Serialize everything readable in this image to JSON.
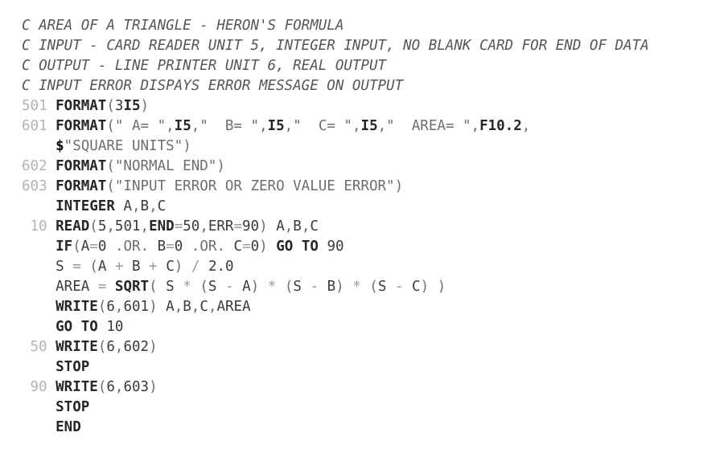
{
  "document": {
    "kind": "fortran-source-listing",
    "language": "FORTRAN",
    "background_color": "#ffffff",
    "text_color": "#3a3a3a",
    "comment_color": "#565656",
    "label_color": "#b4b4b4",
    "operator_color": "#9a9a9a",
    "string_color": "#6e6e6e",
    "keyword_color": "#262626"
  },
  "lines": [
    {
      "type": "comment",
      "label": "",
      "text": "C AREA OF A TRIANGLE - HERON'S FORMULA"
    },
    {
      "type": "comment",
      "label": "",
      "text": "C INPUT - CARD READER UNIT 5, INTEGER INPUT, NO BLANK CARD FOR END OF DATA"
    },
    {
      "type": "comment",
      "label": "",
      "text": "C OUTPUT - LINE PRINTER UNIT 6, REAL OUTPUT"
    },
    {
      "type": "comment",
      "label": "",
      "text": "C INPUT ERROR DISPAYS ERROR MESSAGE ON OUTPUT"
    },
    {
      "type": "statement",
      "label": "501",
      "text": "FORMAT(3I5)"
    },
    {
      "type": "statement",
      "label": "601",
      "text": "FORMAT(\" A= \",I5,\"  B= \",I5,\"  C= \",I5,\"  AREA= \",F10.2,"
    },
    {
      "type": "continuation",
      "label": "",
      "text": "$\"SQUARE UNITS\")"
    },
    {
      "type": "statement",
      "label": "602",
      "text": "FORMAT(\"NORMAL END\")"
    },
    {
      "type": "statement",
      "label": "603",
      "text": "FORMAT(\"INPUT ERROR OR ZERO VALUE ERROR\")"
    },
    {
      "type": "statement",
      "label": "",
      "text": "INTEGER A,B,C"
    },
    {
      "type": "statement",
      "label": "10",
      "text": "READ(5,501,END=50,ERR=90) A,B,C"
    },
    {
      "type": "statement",
      "label": "",
      "text": "IF(A=0 .OR. B=0 .OR. C=0) GO TO 90"
    },
    {
      "type": "statement",
      "label": "",
      "text": "S = (A + B + C) / 2.0"
    },
    {
      "type": "statement",
      "label": "",
      "text": "AREA = SQRT( S * (S - A) * (S - B) * (S - C) )"
    },
    {
      "type": "statement",
      "label": "",
      "text": "WRITE(6,601) A,B,C,AREA"
    },
    {
      "type": "statement",
      "label": "",
      "text": "GO TO 10"
    },
    {
      "type": "statement",
      "label": "50",
      "text": "WRITE(6,602)"
    },
    {
      "type": "statement",
      "label": "",
      "text": "STOP"
    },
    {
      "type": "statement",
      "label": "90",
      "text": "WRITE(6,603)"
    },
    {
      "type": "statement",
      "label": "",
      "text": "STOP"
    },
    {
      "type": "statement",
      "label": "",
      "text": "END"
    }
  ]
}
